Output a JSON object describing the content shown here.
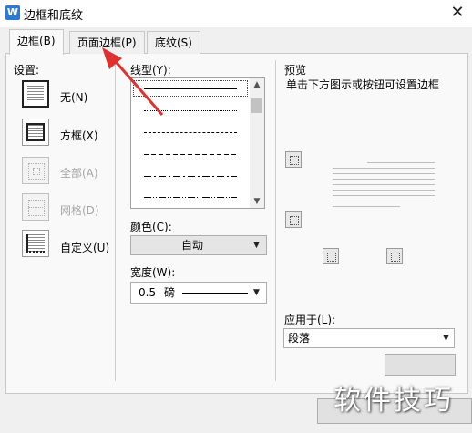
{
  "window": {
    "title": "边框和底纹",
    "app_icon_glyph": "W"
  },
  "tabs": [
    {
      "label": "边框(B)",
      "active": true
    },
    {
      "label": "页面边框(P)",
      "active": false
    },
    {
      "label": "底纹(S)",
      "active": false
    }
  ],
  "settings": {
    "heading": "设置:",
    "items": [
      {
        "label": "无(N)",
        "enabled": true,
        "selected": true,
        "icon": "none-border-icon"
      },
      {
        "label": "方框(X)",
        "enabled": true,
        "selected": false,
        "icon": "box-border-icon"
      },
      {
        "label": "全部(A)",
        "enabled": false,
        "selected": false,
        "icon": "all-border-icon"
      },
      {
        "label": "网格(D)",
        "enabled": false,
        "selected": false,
        "icon": "grid-border-icon"
      },
      {
        "label": "自定义(U)",
        "enabled": true,
        "selected": false,
        "icon": "custom-border-icon"
      }
    ]
  },
  "line_style": {
    "label": "线型(Y):",
    "styles": [
      "solid",
      "dotted",
      "dashed-short",
      "dashed",
      "dash-dot",
      "dash-dot-dot"
    ]
  },
  "color": {
    "label": "颜色(C):",
    "value": "自动"
  },
  "width": {
    "label": "宽度(W):",
    "value": "0.5",
    "unit": "磅"
  },
  "preview": {
    "heading": "预览",
    "hint": "单击下方图示或按钮可设置边框"
  },
  "apply_to": {
    "label": "应用于(L):",
    "value": "段落"
  },
  "watermark": "软件技巧",
  "colors": {
    "annotation_arrow": "#e03131",
    "app_icon": "#2b79d4"
  }
}
